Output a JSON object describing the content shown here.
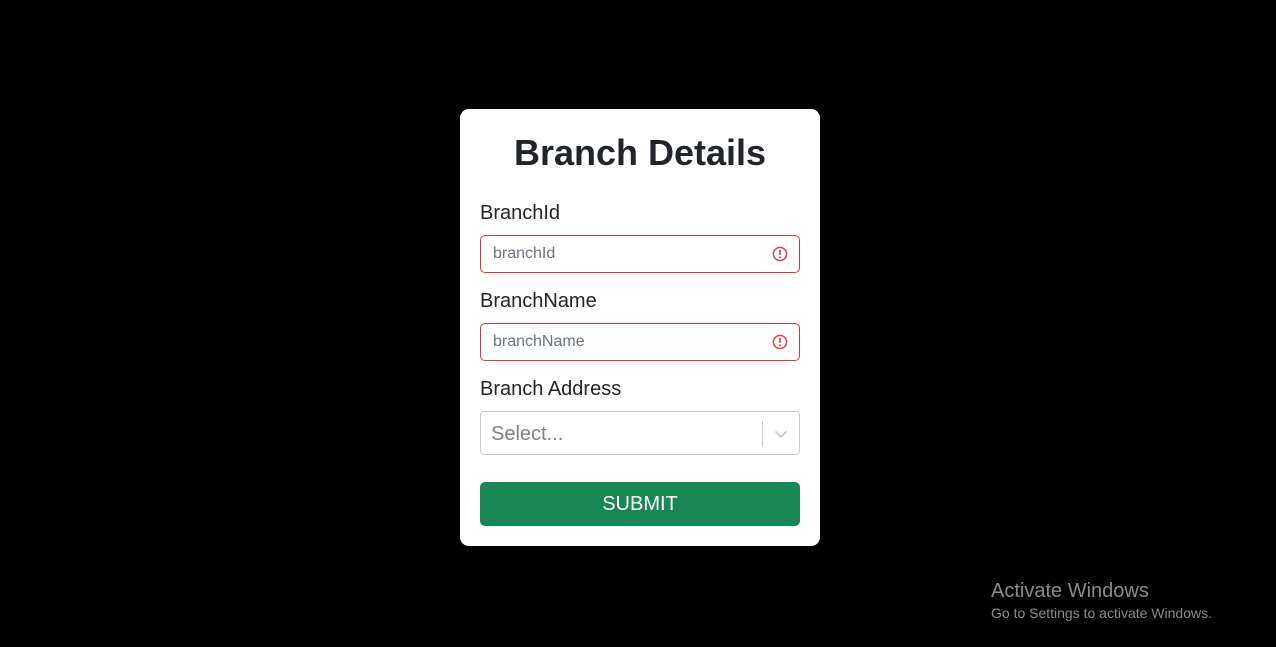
{
  "form": {
    "title": "Branch Details",
    "branch_id": {
      "label": "BranchId",
      "placeholder": "branchId",
      "value": ""
    },
    "branch_name": {
      "label": "BranchName",
      "placeholder": "branchName",
      "value": ""
    },
    "branch_address": {
      "label": "Branch Address",
      "selected": "Select..."
    },
    "submit_label": "SUBMIT"
  },
  "icons": {
    "invalid": "exclamation-circle-icon",
    "dropdown": "chevron-down-icon"
  },
  "colors": {
    "background": "#000000",
    "card": "#ffffff",
    "invalid_border": "#dc3545",
    "submit": "#198754",
    "watermark": "#8a8a8a"
  },
  "watermark": {
    "title": "Activate Windows",
    "subtitle": "Go to Settings to activate Windows."
  }
}
